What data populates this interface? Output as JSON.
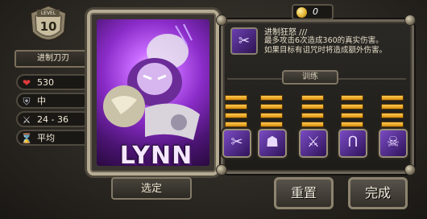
{
  "level": {
    "label": "LEVEL",
    "value": "10"
  },
  "hero_class": "进制刀刃",
  "stats": [
    {
      "icon": "heart-icon",
      "value": "530"
    },
    {
      "icon": "armor-icon",
      "value": "中"
    },
    {
      "icon": "sword-icon",
      "value": "24 - 36"
    },
    {
      "icon": "hourglass-icon",
      "value": "平均"
    }
  ],
  "hero": {
    "name": "LYNN"
  },
  "buttons": {
    "select": "选定",
    "reset": "重置",
    "done": "完成",
    "train": "训练"
  },
  "currency": {
    "coins": "0"
  },
  "skill": {
    "title": "进制狂怒  ///",
    "desc_line1": "最多攻击6次造成360的真实伤害。",
    "desc_line2": "如果目标有诅咒时将造成额外伤害。"
  },
  "skill_tree": [
    {
      "icon": "claw-icon",
      "glyph": "✂",
      "bars": 4
    },
    {
      "icon": "cat-icon",
      "glyph": "☗",
      "bars": 4
    },
    {
      "icon": "blades-icon",
      "glyph": "⚔",
      "bars": 4
    },
    {
      "icon": "horseshoe-icon",
      "glyph": "Ո",
      "bars": 4
    },
    {
      "icon": "skull-icon",
      "glyph": "☠",
      "bars": 4
    }
  ]
}
